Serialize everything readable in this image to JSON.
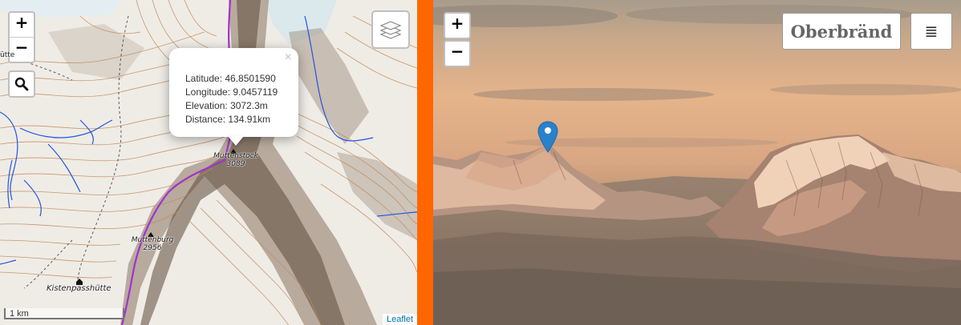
{
  "map": {
    "zoom_in": "+",
    "zoom_out": "−",
    "popup": {
      "close": "×",
      "latitude": "Latitude: 46.8501590",
      "longitude": "Longitude: 9.0457119",
      "elevation": "Elevation: 3072.3m",
      "distance": "Distance: 134.91km"
    },
    "labels": {
      "muttenstock": "Muttenstock",
      "muttenstock_elev": "3089",
      "muttenburg": "Muttenburg",
      "muttenburg_elev": "2956",
      "kistenpasshuette": "Kistenpasshütte",
      "partial_huette": "ütte"
    },
    "scale": "1 km",
    "attribution": "Leaflet"
  },
  "photo": {
    "zoom_in": "+",
    "zoom_out": "−",
    "title": "Oberbränd",
    "menu_icon": "≣"
  },
  "colors": {
    "divider": "#ff6600",
    "marker": "#2a81cb",
    "route": "#a033cc",
    "river": "#2255dd"
  }
}
